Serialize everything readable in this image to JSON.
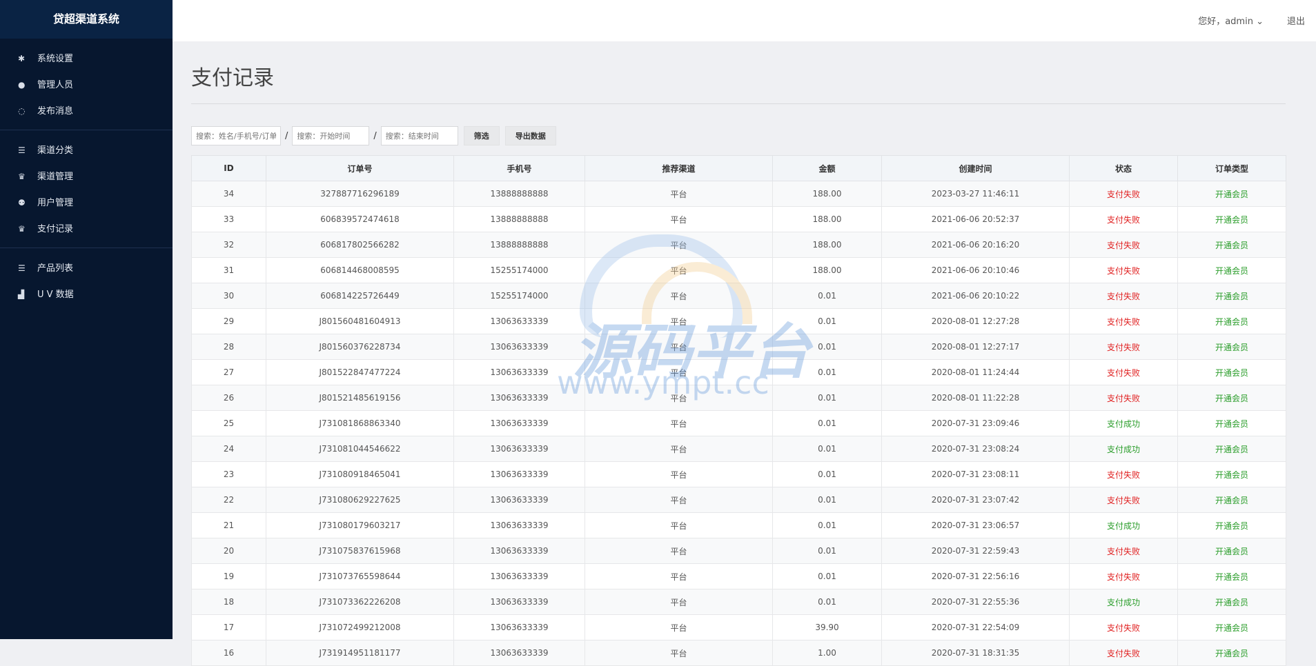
{
  "app": {
    "title": "贷超渠道系统"
  },
  "header": {
    "greeting": "您好，admin",
    "logout": "退出"
  },
  "sidebar": {
    "groups": [
      {
        "items": [
          {
            "label": "系统设置",
            "icon": "gear-icon"
          },
          {
            "label": "管理人员",
            "icon": "user-icon"
          },
          {
            "label": "发布消息",
            "icon": "chat-icon"
          }
        ]
      },
      {
        "items": [
          {
            "label": "渠道分类",
            "icon": "list-icon"
          },
          {
            "label": "渠道管理",
            "icon": "crown-icon"
          },
          {
            "label": "用户管理",
            "icon": "users-icon"
          },
          {
            "label": "支付记录",
            "icon": "crown-icon"
          }
        ]
      },
      {
        "items": [
          {
            "label": "产品列表",
            "icon": "list-icon"
          },
          {
            "label": "U V 数据",
            "icon": "bar-chart-icon"
          }
        ]
      }
    ]
  },
  "page": {
    "title": "支付记录"
  },
  "filters": {
    "search_placeholder": "搜索：姓名/手机号/订单号",
    "start_placeholder": "搜索：开始时间",
    "end_placeholder": "搜索：结束时间",
    "separator": "/",
    "filter_button": "筛选",
    "export_button": "导出数据"
  },
  "table": {
    "columns": [
      "ID",
      "订单号",
      "手机号",
      "推荐渠道",
      "金额",
      "创建时间",
      "状态",
      "订单类型"
    ],
    "rows": [
      [
        "34",
        "327887716296189",
        "13888888888",
        "平台",
        "188.00",
        "2023-03-27 11:46:11",
        "支付失败",
        "开通会员"
      ],
      [
        "33",
        "606839572474618",
        "13888888888",
        "平台",
        "188.00",
        "2021-06-06 20:52:37",
        "支付失败",
        "开通会员"
      ],
      [
        "32",
        "606817802566282",
        "13888888888",
        "平台",
        "188.00",
        "2021-06-06 20:16:20",
        "支付失败",
        "开通会员"
      ],
      [
        "31",
        "606814468008595",
        "15255174000",
        "平台",
        "188.00",
        "2021-06-06 20:10:46",
        "支付失败",
        "开通会员"
      ],
      [
        "30",
        "606814225726449",
        "15255174000",
        "平台",
        "0.01",
        "2021-06-06 20:10:22",
        "支付失败",
        "开通会员"
      ],
      [
        "29",
        "J801560481604913",
        "13063633339",
        "平台",
        "0.01",
        "2020-08-01 12:27:28",
        "支付失败",
        "开通会员"
      ],
      [
        "28",
        "J801560376228734",
        "13063633339",
        "平台",
        "0.01",
        "2020-08-01 12:27:17",
        "支付失败",
        "开通会员"
      ],
      [
        "27",
        "J801522847477224",
        "13063633339",
        "平台",
        "0.01",
        "2020-08-01 11:24:44",
        "支付失败",
        "开通会员"
      ],
      [
        "26",
        "J801521485619156",
        "13063633339",
        "平台",
        "0.01",
        "2020-08-01 11:22:28",
        "支付失败",
        "开通会员"
      ],
      [
        "25",
        "J731081868863340",
        "13063633339",
        "平台",
        "0.01",
        "2020-07-31 23:09:46",
        "支付成功",
        "开通会员"
      ],
      [
        "24",
        "J731081044546622",
        "13063633339",
        "平台",
        "0.01",
        "2020-07-31 23:08:24",
        "支付成功",
        "开通会员"
      ],
      [
        "23",
        "J731080918465041",
        "13063633339",
        "平台",
        "0.01",
        "2020-07-31 23:08:11",
        "支付失败",
        "开通会员"
      ],
      [
        "22",
        "J731080629227625",
        "13063633339",
        "平台",
        "0.01",
        "2020-07-31 23:07:42",
        "支付失败",
        "开通会员"
      ],
      [
        "21",
        "J731080179603217",
        "13063633339",
        "平台",
        "0.01",
        "2020-07-31 23:06:57",
        "支付成功",
        "开通会员"
      ],
      [
        "20",
        "J731075837615968",
        "13063633339",
        "平台",
        "0.01",
        "2020-07-31 22:59:43",
        "支付失败",
        "开通会员"
      ],
      [
        "19",
        "J731073765598644",
        "13063633339",
        "平台",
        "0.01",
        "2020-07-31 22:56:16",
        "支付失败",
        "开通会员"
      ],
      [
        "18",
        "J731073362226208",
        "13063633339",
        "平台",
        "0.01",
        "2020-07-31 22:55:36",
        "支付成功",
        "开通会员"
      ],
      [
        "17",
        "J731072499212008",
        "13063633339",
        "平台",
        "39.90",
        "2020-07-31 22:54:09",
        "支付失败",
        "开通会员"
      ],
      [
        "16",
        "J731914951181177",
        "13063633339",
        "平台",
        "1.00",
        "2020-07-31 18:31:35",
        "支付失败",
        "开通会员"
      ]
    ]
  },
  "watermark": {
    "text": "源码平台",
    "url": "www.ympt.cc"
  },
  "colors": {
    "sidebar_bg": "#07172f",
    "brand_bg": "#0a2344",
    "fail": "#e02020",
    "success": "#2a9d2a"
  }
}
